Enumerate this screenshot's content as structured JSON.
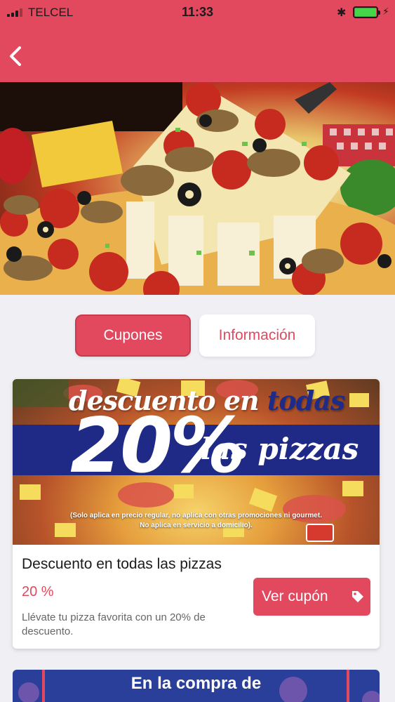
{
  "status_bar": {
    "carrier": "TELCEL",
    "time": "11:33",
    "battery_color": "#43d649"
  },
  "nav": {
    "back_icon": "chevron-left-icon",
    "background": "#e2495f"
  },
  "hero": {
    "description_icon": "pizza-photo",
    "carousel_count": 2,
    "carousel_active": 2
  },
  "tabs": [
    {
      "label": "Cupones",
      "active": true
    },
    {
      "label": "Información",
      "active": false
    }
  ],
  "coupon": {
    "banner": {
      "headline_a": "descuento en ",
      "headline_b": "todas",
      "big_percent": "20%",
      "subline": "las pizzas",
      "fine_print_1": "(Solo aplica en precio regular, no aplica con otras promociones ni gourmet.",
      "fine_print_2": "No aplica en servicio a domicilio)."
    },
    "title": "Descuento en todas las pizzas",
    "discount": "20 %",
    "description": "Llévate tu pizza favorita con un 20% de descuento.",
    "button_label": "Ver cupón",
    "button_icon": "tag-icon"
  },
  "next_card": {
    "headline": "En la compra de"
  },
  "colors": {
    "accent": "#e2495f",
    "banner_blue": "#1f2a86",
    "background": "#efeff4"
  }
}
